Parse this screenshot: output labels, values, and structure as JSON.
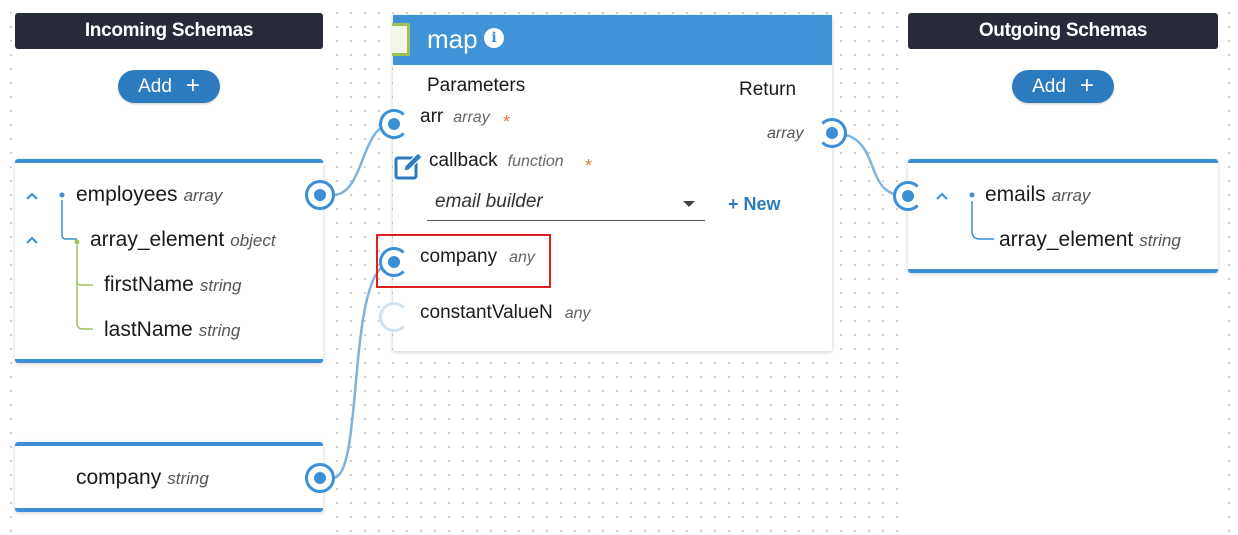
{
  "incoming": {
    "header": "Incoming Schemas",
    "add_label": "Add",
    "employees_card": {
      "fields": [
        {
          "name": "employees",
          "type": "array"
        },
        {
          "name": "array_element",
          "type": "object"
        },
        {
          "name": "firstName",
          "type": "string"
        },
        {
          "name": "lastName",
          "type": "string"
        }
      ]
    },
    "company_card": {
      "field": {
        "name": "company",
        "type": "string"
      }
    }
  },
  "outgoing": {
    "header": "Outgoing Schemas",
    "add_label": "Add",
    "emails_card": {
      "fields": [
        {
          "name": "emails",
          "type": "array"
        },
        {
          "name": "array_element",
          "type": "string"
        }
      ]
    }
  },
  "map_node": {
    "title": "map",
    "parameters_label": "Parameters",
    "return_label": "Return",
    "return_type": "array",
    "params": [
      {
        "name": "arr",
        "type": "array",
        "required": "*"
      },
      {
        "name": "callback",
        "type": "function",
        "required": "*"
      },
      {
        "name": "company",
        "type": "any"
      },
      {
        "name": "constantValueN",
        "type": "any"
      }
    ],
    "callback_select": {
      "value": "email builder"
    },
    "new_button": "+ New"
  },
  "colors": {
    "accent": "#3a8fd6",
    "header_dark": "#272a38",
    "highlight": "#e02020",
    "required_star": "#e07a3a"
  }
}
